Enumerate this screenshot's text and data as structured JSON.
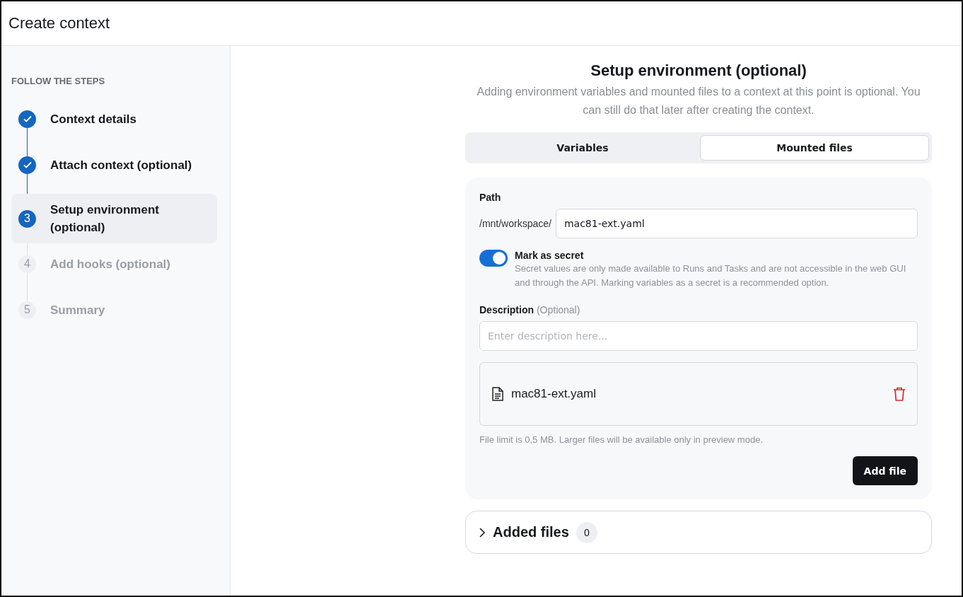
{
  "window": {
    "title": "Create context"
  },
  "sidebar": {
    "heading": "FOLLOW THE STEPS",
    "steps": [
      {
        "label": "Context details",
        "done": true,
        "selected": false
      },
      {
        "label": "Attach context (optional)",
        "done": true,
        "selected": false
      },
      {
        "number": "3",
        "label": "Setup environment (optional)",
        "done": false,
        "selected": true
      },
      {
        "number": "4",
        "label": "Add hooks (optional)",
        "done": false,
        "selected": false
      },
      {
        "number": "5",
        "label": "Summary",
        "done": false,
        "selected": false
      }
    ]
  },
  "main": {
    "title": "Setup environment (optional)",
    "subtitle": "Adding environment variables and mounted files to a context at this point is optional. You can still do that later after creating the context.",
    "tabs": [
      {
        "label": "Variables",
        "selected": false
      },
      {
        "label": "Mounted files",
        "selected": true
      }
    ],
    "form": {
      "path_label": "Path",
      "path_prefix": "/mnt/workspace/",
      "path_value": "mac81-ext.yaml",
      "secret": {
        "label": "Mark as secret",
        "on": true,
        "help": "Secret values are only made available to Runs and Tasks and are not accessible in the web GUI and through the API. Marking variables as a secret is a recommended option."
      },
      "description_label": "Description",
      "description_hint": "(Optional)",
      "description_placeholder": "Enter description here...",
      "file": {
        "name": "mac81-ext.yaml"
      },
      "file_note": "File limit is 0,5 MB. Larger files will be available only in preview mode.",
      "add_button": "Add file"
    },
    "added_files": {
      "label": "Added files",
      "count": "0",
      "expanded": false
    }
  }
}
